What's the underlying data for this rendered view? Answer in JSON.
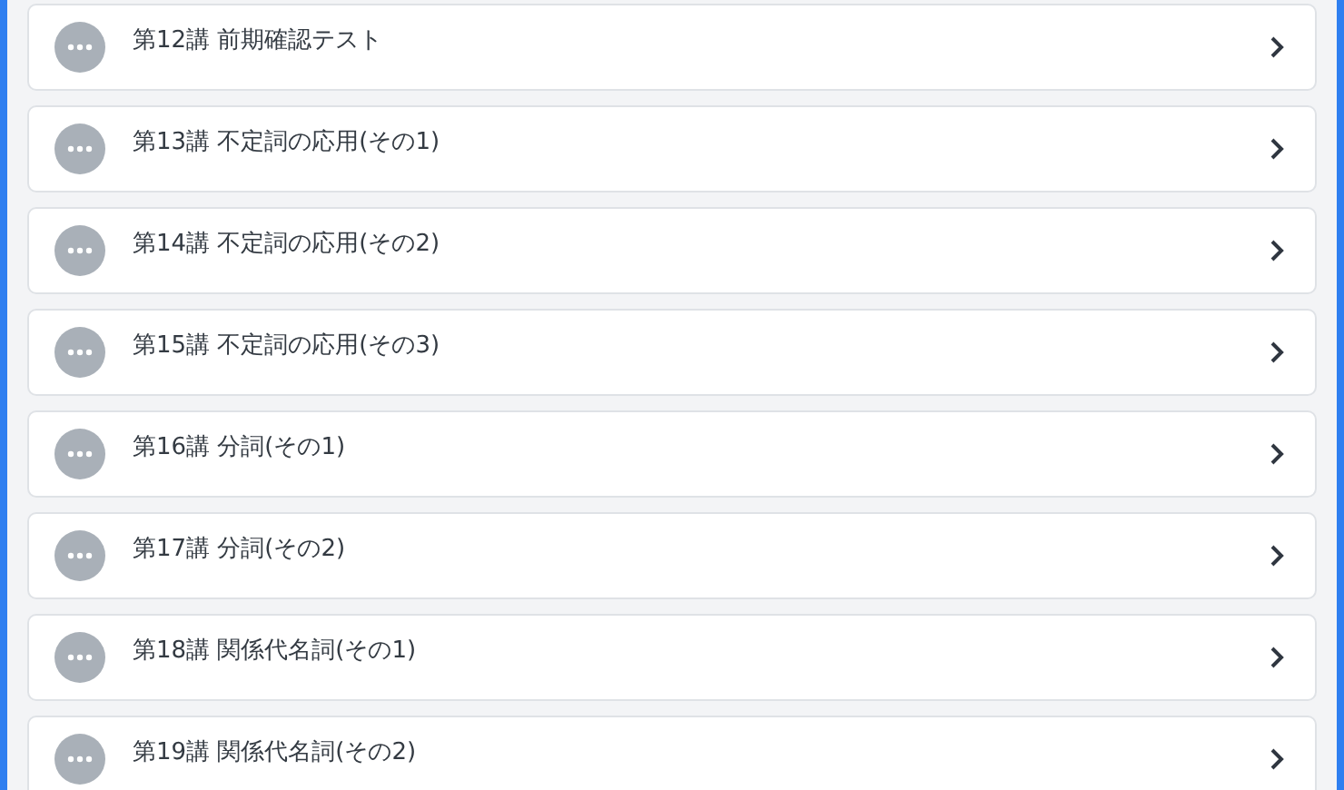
{
  "lessons": [
    {
      "title": "第12講 前期確認テスト"
    },
    {
      "title": "第13講 不定詞の応用(その1)"
    },
    {
      "title": "第14講 不定詞の応用(その2)"
    },
    {
      "title": "第15講 不定詞の応用(その3)"
    },
    {
      "title": "第16講 分詞(その1)"
    },
    {
      "title": "第17講 分詞(その2)"
    },
    {
      "title": "第18講 関係代名詞(その1)"
    },
    {
      "title": "第19講 関係代名詞(その2)"
    }
  ]
}
